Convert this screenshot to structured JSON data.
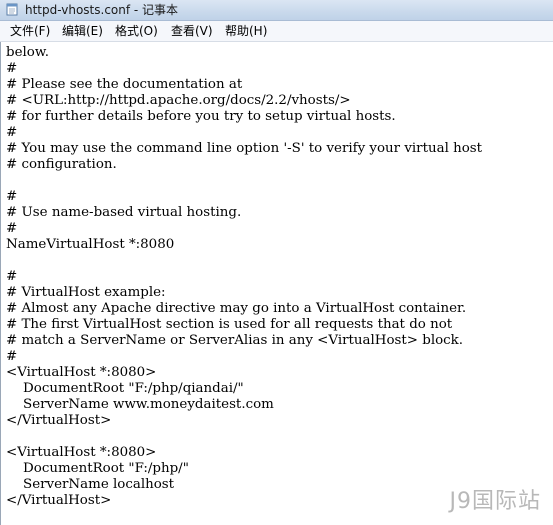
{
  "window": {
    "title": "httpd-vhosts.conf - 记事本"
  },
  "menu": {
    "file": "文件(F)",
    "edit": "编辑(E)",
    "format": "格式(O)",
    "view": "查看(V)",
    "help": "帮助(H)"
  },
  "document": {
    "lines": [
      "below.",
      "#",
      "# Please see the documentation at",
      "# <URL:http://httpd.apache.org/docs/2.2/vhosts/>",
      "# for further details before you try to setup virtual hosts.",
      "#",
      "# You may use the command line option '-S' to verify your virtual host",
      "# configuration.",
      "",
      "#",
      "# Use name-based virtual hosting.",
      "#",
      "NameVirtualHost *:8080",
      "",
      "#",
      "# VirtualHost example:",
      "# Almost any Apache directive may go into a VirtualHost container.",
      "# The first VirtualHost section is used for all requests that do not",
      "# match a ServerName or ServerAlias in any <VirtualHost> block.",
      "#",
      "<VirtualHost *:8080>",
      "    DocumentRoot \"F:/php/qiandai/\"",
      "    ServerName www.moneydaitest.com",
      "</VirtualHost>",
      "",
      "<VirtualHost *:8080>",
      "    DocumentRoot \"F:/php/\"",
      "    ServerName localhost",
      "</VirtualHost>"
    ]
  },
  "watermark": "J9国际站",
  "icons": {
    "app": "notepad-icon"
  },
  "colors": {
    "titlebar": "#c9d9ec",
    "menubar": "#f5f7fb",
    "text": "#000000"
  }
}
